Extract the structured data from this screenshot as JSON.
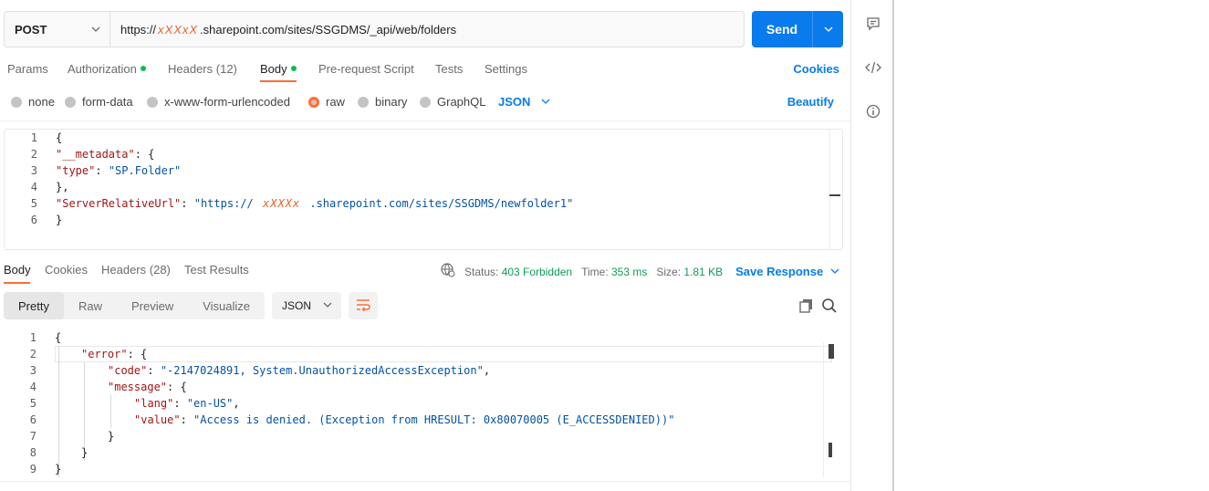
{
  "request": {
    "method": "POST",
    "url_prefix": "https://",
    "url_redacted": "xXXxX",
    "url_suffix": ".sharepoint.com/sites/SSGDMS/_api/web/folders",
    "send_label": "Send"
  },
  "request_tabs": [
    {
      "label": "Params"
    },
    {
      "label": "Authorization"
    },
    {
      "label": "Headers",
      "count": "(12)"
    },
    {
      "label": "Body"
    },
    {
      "label": "Pre-request Script"
    },
    {
      "label": "Tests"
    },
    {
      "label": "Settings"
    }
  ],
  "cookies_label": "Cookies",
  "body_types": [
    "none",
    "form-data",
    "x-www-form-urlencoded",
    "raw",
    "binary",
    "GraphQL"
  ],
  "body_language": "JSON",
  "beautify_label": "Beautify",
  "request_body_lines": [
    {
      "n": "1",
      "parts": [
        [
          "p",
          "{"
        ]
      ]
    },
    {
      "n": "2",
      "parts": [
        [
          "k",
          "\"__metadata\""
        ],
        [
          "p",
          ": {"
        ]
      ]
    },
    {
      "n": "3",
      "parts": [
        [
          "k",
          "\"type\""
        ],
        [
          "p",
          ": "
        ],
        [
          "s",
          "\"SP.Folder\""
        ]
      ]
    },
    {
      "n": "4",
      "parts": [
        [
          "p",
          "},"
        ]
      ]
    },
    {
      "n": "5",
      "parts": [
        [
          "k",
          "\"ServerRelativeUrl\""
        ],
        [
          "p",
          ": "
        ],
        [
          "s",
          "\"https://"
        ],
        [
          "r",
          " xXXXx "
        ],
        [
          "s",
          ".sharepoint.com/sites/SSGDMS/newfolder1\""
        ]
      ]
    },
    {
      "n": "6",
      "parts": [
        [
          "p",
          "}"
        ]
      ]
    }
  ],
  "response_tabs": [
    {
      "label": "Body"
    },
    {
      "label": "Cookies"
    },
    {
      "label": "Headers",
      "count": "(28)"
    },
    {
      "label": "Test Results"
    }
  ],
  "response_status": {
    "status_label": "Status:",
    "status_value": "403 Forbidden",
    "time_label": "Time:",
    "time_value": "353 ms",
    "size_label": "Size:",
    "size_value": "1.81 KB",
    "save_label": "Save Response"
  },
  "view_modes": [
    "Pretty",
    "Raw",
    "Preview",
    "Visualize"
  ],
  "response_format": "JSON",
  "response_body_lines": [
    {
      "n": "1",
      "indent": 0,
      "parts": [
        [
          "p",
          "{"
        ]
      ]
    },
    {
      "n": "2",
      "indent": 1,
      "parts": [
        [
          "k",
          "\"error\""
        ],
        [
          "p",
          ": {"
        ]
      ]
    },
    {
      "n": "3",
      "indent": 2,
      "parts": [
        [
          "k",
          "\"code\""
        ],
        [
          "p",
          ": "
        ],
        [
          "s",
          "\"-2147024891, System.UnauthorizedAccessException\""
        ],
        [
          "p",
          ","
        ]
      ]
    },
    {
      "n": "4",
      "indent": 2,
      "parts": [
        [
          "k",
          "\"message\""
        ],
        [
          "p",
          ": {"
        ]
      ]
    },
    {
      "n": "5",
      "indent": 3,
      "parts": [
        [
          "k",
          "\"lang\""
        ],
        [
          "p",
          ": "
        ],
        [
          "s",
          "\"en-US\""
        ],
        [
          "p",
          ","
        ]
      ]
    },
    {
      "n": "6",
      "indent": 3,
      "parts": [
        [
          "k",
          "\"value\""
        ],
        [
          "p",
          ": "
        ],
        [
          "s",
          "\"Access is denied. (Exception from HRESULT: 0x80070005 (E_ACCESSDENIED))\""
        ]
      ]
    },
    {
      "n": "7",
      "indent": 2,
      "parts": [
        [
          "p",
          "}"
        ]
      ]
    },
    {
      "n": "8",
      "indent": 1,
      "parts": [
        [
          "p",
          "}"
        ]
      ]
    },
    {
      "n": "9",
      "indent": 0,
      "parts": [
        [
          "p",
          "}"
        ]
      ]
    }
  ],
  "rail_icons": [
    "comment-icon",
    "code-icon",
    "info-icon"
  ],
  "colors": {
    "accent": "#ff6c37",
    "primary": "#097bed",
    "success": "#0cbb52"
  }
}
